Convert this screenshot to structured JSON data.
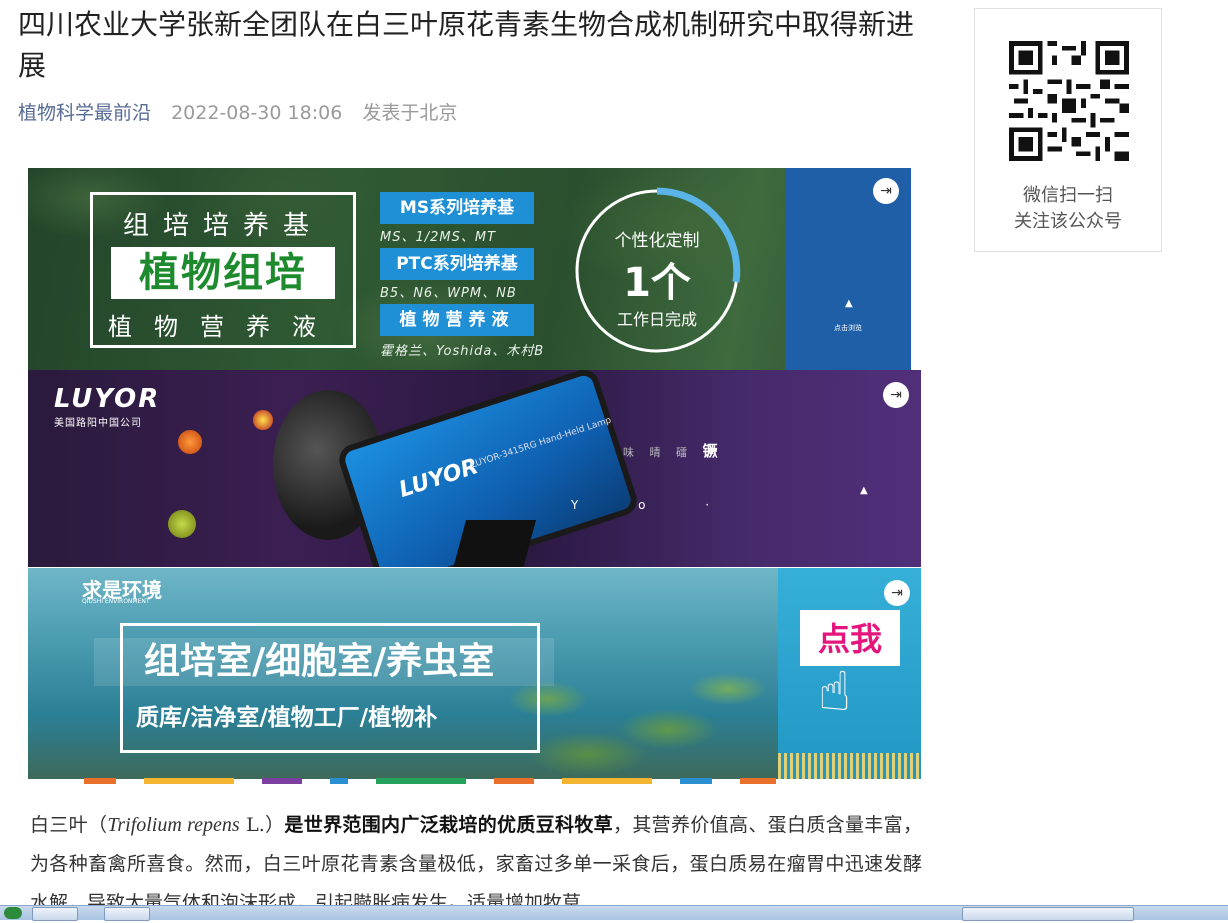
{
  "article": {
    "title": "四川农业大学张新全团队在白三叶原花青素生物合成机制研究中取得新进展",
    "account_name": "植物科学最前沿",
    "publish_time": "2022-08-30 18:06",
    "location": "发表于北京"
  },
  "banner1": {
    "box_line1": "组培培养基",
    "box_highlight": "植物组培",
    "box_line3": "植物营养液",
    "pill1": "MS系列培养基",
    "pill1_sub": "MS、1/2MS、MT",
    "pill2": "PTC系列培养基",
    "pill2_sub": "B5、N6、WPM、NB",
    "pill3": "植物营养液",
    "pill3_sub": "霍格兰、Yoshida、木村B",
    "circle_top": "个性化定制",
    "circle_num": "1个",
    "circle_bottom": "工作日完成",
    "side_caption": "点击浏览"
  },
  "banner2": {
    "logo": "LUYOR",
    "logo_sub": "美国路阳中国公司",
    "lamp_brand": "LUYOR",
    "lamp_model": "LUYOR-3415RG Hand-Held Lamp",
    "chars": "味 晴 礌",
    "chars_bold": "镢",
    "letters": "Y o ·"
  },
  "banner3": {
    "logo": "求是环境",
    "logo_sub": "QIUSHI ENVIRONMENT",
    "headline": "组培室/细胞室/养虫室",
    "subline": "质库/洁净室/植物工厂/植物补",
    "cta": "点我"
  },
  "body": {
    "p1_start": "白三叶（",
    "p1_species": "Trifolium repens",
    "p1_author": " L.）",
    "p1_bold": "是世界范围内广泛栽培的优质豆科牧草",
    "p1_rest": "，其营养价值高、蛋白质含量丰富，为各种畜禽所喜食。然而，白三叶原花青素含量极低，家畜过多单一采食后，蛋白质易在瘤胃中迅速发酵水解，导致大量气体和泡沫形成，引起臌胀病发生。适量增加牧草"
  },
  "sidebar": {
    "qr_caption1": "微信扫一扫",
    "qr_caption2": "关注该公众号"
  },
  "colors": {
    "account_link": "#576b95",
    "banner1_bg": "#2f5a33",
    "banner1_pill": "#1f8fd6",
    "banner1_side": "#1e5fa8",
    "banner2_bg": "#3b1f52",
    "banner3_bg": "#4a9bb0",
    "cta_text": "#e4167e"
  },
  "icons": [
    "enter-icon",
    "qr-code-icon",
    "pointer-hand-icon"
  ]
}
